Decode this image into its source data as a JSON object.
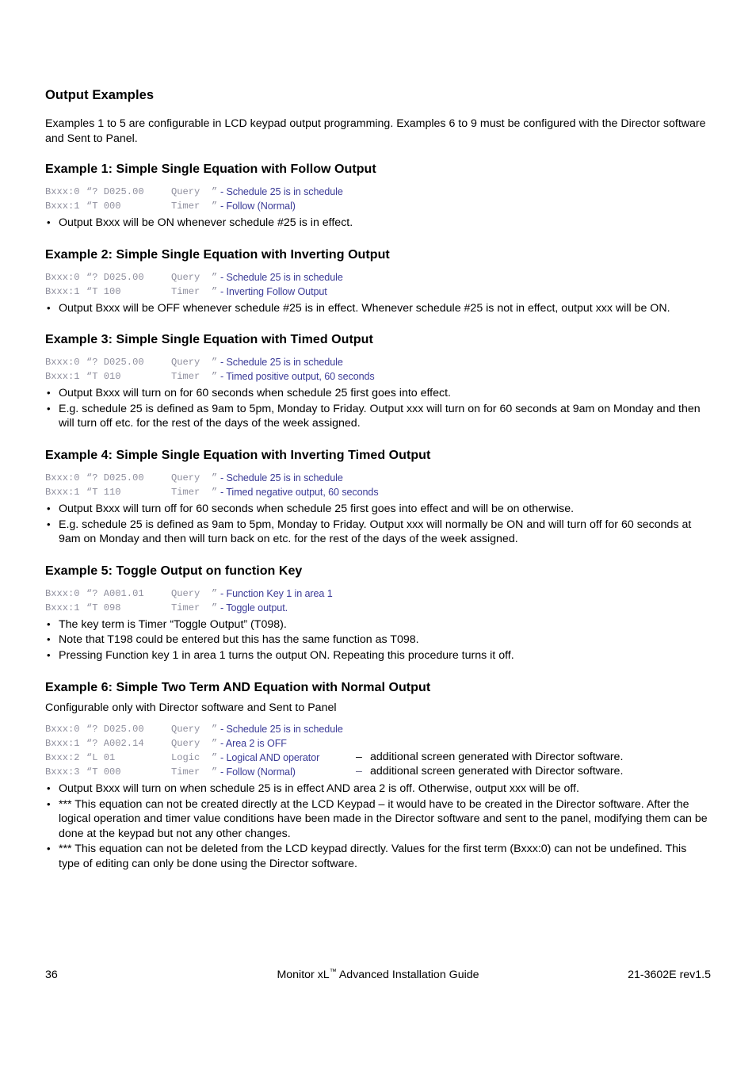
{
  "page": {
    "section_title": "Output Examples",
    "intro": "Examples 1 to 5 are configurable in LCD keypad output programming. Examples 6 to 9 must be configured with the Director software and Sent to Panel."
  },
  "colors": {
    "code_text": "#8f8f9e",
    "code_description": "#3b3b97",
    "body_text": "#000000",
    "background": "#ffffff"
  },
  "examples": [
    {
      "title": "Example 1: Simple Single Equation with Follow Output",
      "subtitle": "",
      "code": [
        {
          "term": "Bxxx:0",
          "quote": "“",
          "expr": "? D025.00",
          "kind": "Query",
          "endquote": "”",
          "desc": "- Schedule 25 is in schedule",
          "aside": ""
        },
        {
          "term": "Bxxx:1",
          "quote": "“",
          "expr": "T 000",
          "kind": "Timer",
          "endquote": "”",
          "desc": "- Follow (Normal)",
          "aside": ""
        }
      ],
      "bullets": [
        "Output Bxxx will be ON whenever schedule #25 is in effect."
      ]
    },
    {
      "title": "Example 2: Simple Single Equation with Inverting Output",
      "subtitle": "",
      "code": [
        {
          "term": "Bxxx:0",
          "quote": "“",
          "expr": "? D025.00",
          "kind": "Query",
          "endquote": "”",
          "desc": "- Schedule 25 is in schedule",
          "aside": ""
        },
        {
          "term": "Bxxx:1",
          "quote": "“",
          "expr": "T 100",
          "kind": "Timer",
          "endquote": "”",
          "desc": "- Inverting Follow Output",
          "aside": ""
        }
      ],
      "bullets": [
        "Output Bxxx will be OFF whenever schedule #25 is in effect. Whenever schedule #25 is not in effect, output xxx will be ON."
      ]
    },
    {
      "title": "Example 3: Simple Single Equation with Timed Output",
      "subtitle": "",
      "code": [
        {
          "term": "Bxxx:0",
          "quote": "“",
          "expr": "? D025.00",
          "kind": "Query",
          "endquote": "”",
          "desc": "- Schedule 25 is in schedule",
          "aside": ""
        },
        {
          "term": "Bxxx:1",
          "quote": "“",
          "expr": "T 010",
          "kind": "Timer",
          "endquote": "”",
          "desc": "- Timed positive output, 60 seconds",
          "aside": ""
        }
      ],
      "bullets": [
        "Output Bxxx will turn on for 60 seconds when schedule 25 first goes into effect.",
        "E.g. schedule 25 is defined as 9am to 5pm, Monday to Friday. Output xxx will turn on for 60 seconds at 9am on Monday and then will turn off etc. for the rest of the days of the week assigned."
      ]
    },
    {
      "title": "Example 4: Simple Single Equation with Inverting Timed Output",
      "subtitle": "",
      "code": [
        {
          "term": "Bxxx:0",
          "quote": "“",
          "expr": "? D025.00",
          "kind": "Query",
          "endquote": "”",
          "desc": "- Schedule 25 is in schedule",
          "aside": ""
        },
        {
          "term": "Bxxx:1",
          "quote": "“",
          "expr": "T 110",
          "kind": "Timer",
          "endquote": "”",
          "desc": "- Timed negative output, 60 seconds",
          "aside": ""
        }
      ],
      "bullets": [
        "Output Bxxx will turn off for 60 seconds when schedule 25 first goes into effect and will be on otherwise.",
        "E.g. schedule 25 is defined as 9am to 5pm, Monday to Friday.  Output xxx will normally be ON and will turn off for 60 seconds at 9am on Monday and then will turn back on etc. for the rest of the days of the week assigned."
      ]
    },
    {
      "title": "Example 5: Toggle Output on function Key",
      "subtitle": "",
      "code": [
        {
          "term": "Bxxx:0",
          "quote": "“",
          "expr": "? A001.01",
          "kind": "Query",
          "endquote": "”",
          "desc": "- Function Key 1 in area 1",
          "aside": ""
        },
        {
          "term": "Bxxx:1",
          "quote": "“",
          "expr": "T 098",
          "kind": "Timer",
          "endquote": "”",
          "desc": "- Toggle output.",
          "aside": ""
        }
      ],
      "bullets": [
        "The key term is Timer “Toggle Output” (T098).",
        "Note that T198 could be entered but this has the same function as T098.",
        "Pressing Function key 1 in area 1 turns the output ON. Repeating this procedure turns it off."
      ]
    },
    {
      "title": "Example 6: Simple Two Term AND Equation with Normal Output",
      "subtitle": "Configurable only with Director software and Sent to Panel",
      "code": [
        {
          "term": "Bxxx:0",
          "quote": "“",
          "expr": "? D025.00",
          "kind": "Query",
          "endquote": "”",
          "desc": "- Schedule 25 is in schedule",
          "aside": ""
        },
        {
          "term": "Bxxx:1",
          "quote": "“",
          "expr": "? A002.14",
          "kind": "Query",
          "endquote": "”",
          "desc": "- Area 2 is OFF",
          "aside": ""
        },
        {
          "term": "Bxxx:2",
          "quote": "“",
          "expr": "L 01",
          "kind": "Logic",
          "endquote": "”",
          "desc": "- Logical AND operator",
          "aside": "additional screen generated with Director software."
        },
        {
          "term": "Bxxx:3",
          "quote": "“",
          "expr": "T 000",
          "kind": "Timer",
          "endquote": "”",
          "desc": "- Follow (Normal)",
          "aside": "additional screen generated with Director software."
        }
      ],
      "bullets": [
        "Output Bxxx will turn on when schedule 25 is in effect AND area 2 is off. Otherwise, output xxx will be off.",
        "*** This equation can not be created directly at the LCD Keypad – it would have to be created in the Director software. After the logical operation and timer value conditions have been made in the Director software and sent to the panel, modifying them can be done at the keypad but not any other changes.",
        "*** This equation can not be deleted from the LCD keypad directly. Values for the first term (Bxxx:0) can not be undefined. This type of editing can only be done using the Director software."
      ]
    }
  ],
  "footer": {
    "page_number": "36",
    "title_main": "Monitor xL",
    "title_tm": "™",
    "title_rest": " Advanced Installation Guide",
    "doc_ref": "21-3602E rev1.5"
  },
  "aside_dash": "–"
}
